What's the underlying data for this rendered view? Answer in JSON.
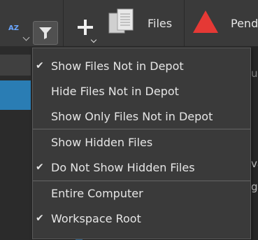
{
  "toolbar": {
    "sort_icon_text": "AZ",
    "files_label": "Files",
    "pending_label": "Pend"
  },
  "background": {
    "right_text_1": "u",
    "right_text_2": "va",
    "right_text_3": "g"
  },
  "menu": {
    "items": [
      {
        "label": "Show Files Not in Depot",
        "checked": true
      },
      {
        "label": "Hide Files Not in Depot",
        "checked": false
      },
      {
        "label": "Show Only Files Not in Depot",
        "checked": false
      },
      {
        "label": "Show Hidden Files",
        "checked": false
      },
      {
        "label": "Do Not Show Hidden Files",
        "checked": true
      },
      {
        "label": "Entire Computer",
        "checked": false
      },
      {
        "label": "Workspace Root",
        "checked": true
      }
    ],
    "check_glyph": "✔"
  },
  "colors": {
    "accent": "#2a7db4",
    "warning_triangle": "#e53935",
    "menu_bg": "#3a3a3a"
  }
}
